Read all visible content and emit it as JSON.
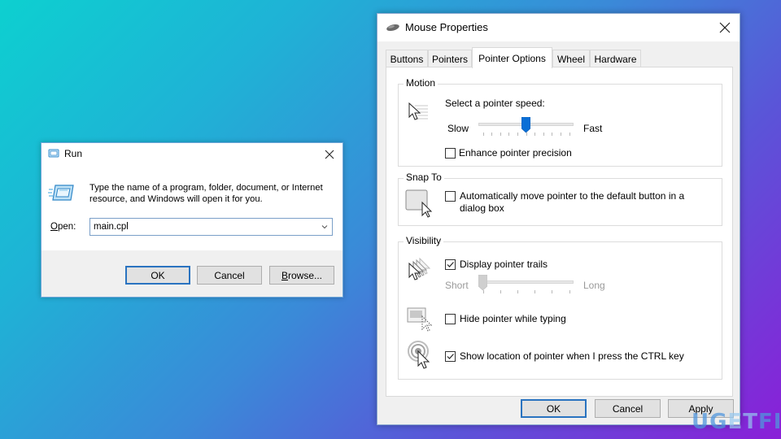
{
  "run_dialog": {
    "title": "Run",
    "description": "Type the name of a program, folder, document, or Internet resource, and Windows will open it for you.",
    "open_label_accel": "O",
    "open_label_rest": "pen:",
    "open_value": "main.cpl",
    "buttons": {
      "ok": "OK",
      "cancel": "Cancel",
      "browse_accel": "B",
      "browse_rest": "rowse..."
    }
  },
  "mouse_properties": {
    "title": "Mouse Properties",
    "tabs": [
      {
        "label": "Buttons",
        "active": false
      },
      {
        "label": "Pointers",
        "active": false
      },
      {
        "label": "Pointer Options",
        "active": true
      },
      {
        "label": "Wheel",
        "active": false
      },
      {
        "label": "Hardware",
        "active": false
      }
    ],
    "motion": {
      "title": "Motion",
      "speed_label": "Select a pointer speed:",
      "slow": "Slow",
      "fast": "Fast",
      "speed_value": 6,
      "speed_min": 1,
      "speed_max": 11,
      "enhance_precision_label": "Enhance pointer precision",
      "enhance_precision_checked": false
    },
    "snap_to": {
      "title": "Snap To",
      "auto_move_label_line1": "Automatically move pointer to the default button in a",
      "auto_move_label_line2": "dialog box",
      "auto_move_checked": false
    },
    "visibility": {
      "title": "Visibility",
      "trails_label": "Display pointer trails",
      "trails_checked": true,
      "short": "Short",
      "long": "Long",
      "trails_value": 1,
      "trails_min": 1,
      "trails_max": 6,
      "hide_typing_label": "Hide pointer while typing",
      "hide_typing_checked": false,
      "show_ctrl_label": "Show location of pointer when I press the CTRL key",
      "show_ctrl_checked": true
    },
    "buttons": {
      "ok": "OK",
      "cancel": "Cancel",
      "apply": "Apply"
    }
  },
  "watermark": {
    "left": "UG",
    "mid": "ET",
    "right": "FIX"
  }
}
